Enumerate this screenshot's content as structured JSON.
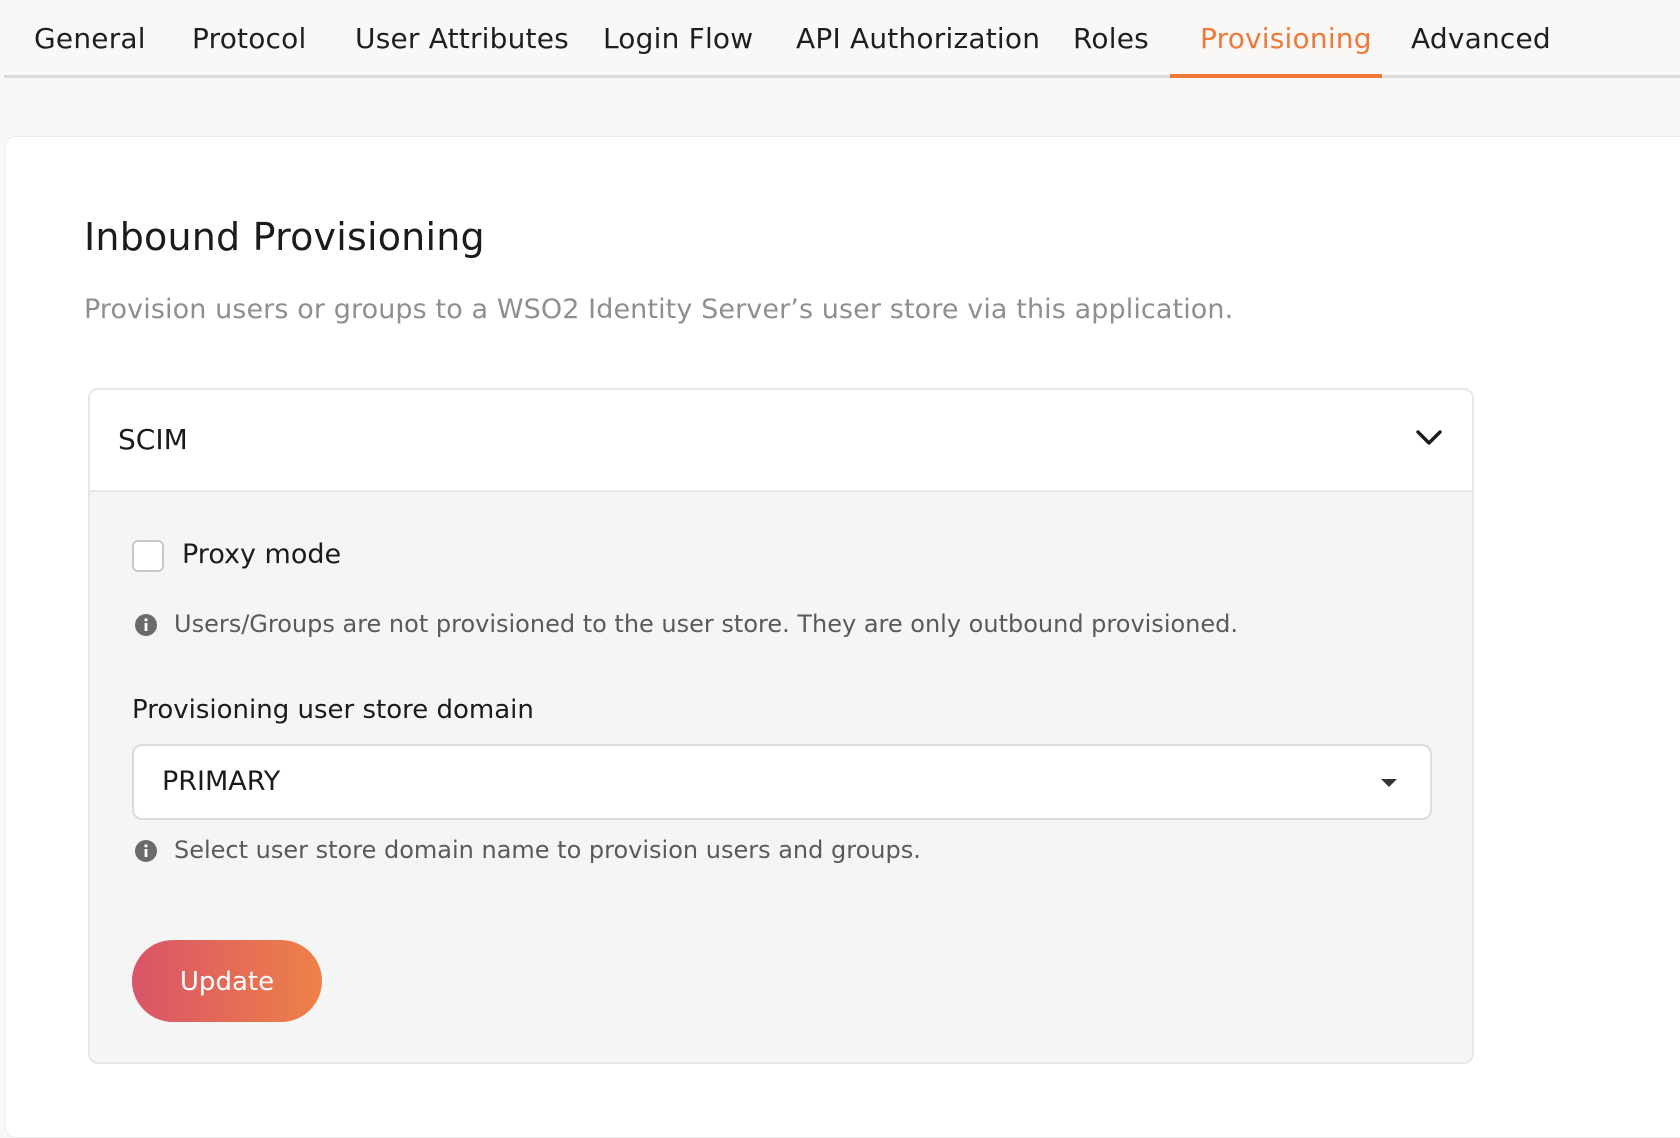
{
  "tabs": [
    {
      "label": "General"
    },
    {
      "label": "Protocol"
    },
    {
      "label": "User Attributes"
    },
    {
      "label": "Login Flow"
    },
    {
      "label": "API Authorization"
    },
    {
      "label": "Roles"
    },
    {
      "label": "Provisioning",
      "active": true
    },
    {
      "label": "Advanced"
    }
  ],
  "section": {
    "title": "Inbound Provisioning",
    "description": "Provision users or groups to a WSO2 Identity Server’s user store via this application."
  },
  "scim": {
    "title": "SCIM",
    "expanded": true,
    "proxy_mode": {
      "label": "Proxy mode",
      "checked": false,
      "hint": "Users/Groups are not provisioned to the user store. They are only outbound provisioned."
    },
    "user_store_domain": {
      "label": "Provisioning user store domain",
      "value": "PRIMARY",
      "hint": "Select user store domain name to provision users and groups."
    },
    "update_label": "Update"
  },
  "colors": {
    "accent": "#ee7a3a",
    "button_gradient_start": "#d95469",
    "button_gradient_end": "#ee8147"
  }
}
